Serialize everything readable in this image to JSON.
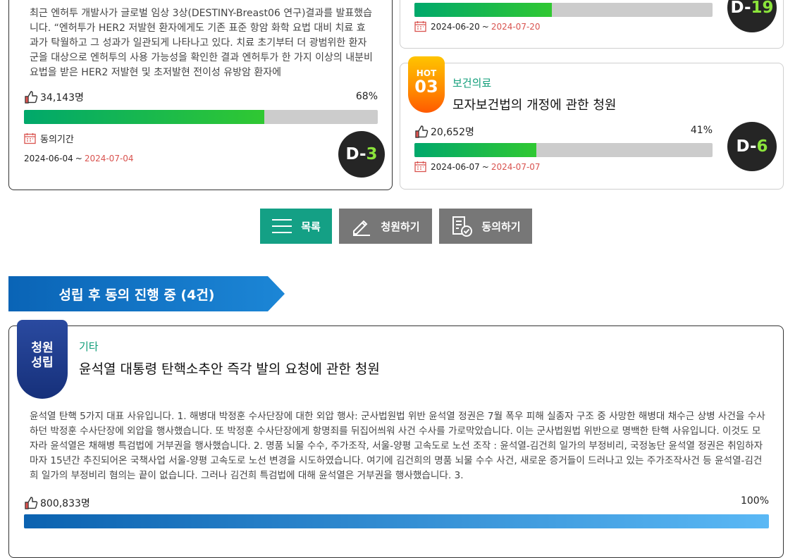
{
  "card1": {
    "description": "최근 엔허투 개발사가 글로벌 임상 3상(DESTINY-Breast06 연구)결과를 발표했습니다. “엔허투가 HER2 저발현 환자에게도 기존 표준 항암 화학 요법 대비 치료 효과가 탁월하고 그 성과가 일관되게 나타나고 있다. 치료 초기부터 더 광범위한 환자군을 대상으로 엔허투의 사용 가능성을 확인한 결과 엔허투가 한 가지 이상의 내분비 요법을 받은 HER2 저발현 및 초저발현 전이성 유방암 환자에",
    "count": "34,143명",
    "percent": "68%",
    "progress": 0.68,
    "period_label": "동의기간",
    "start_date": "2024-06-04",
    "sep": "~",
    "end_date": "2024-07-04",
    "d_prefix": "D-",
    "d_num": "3"
  },
  "card2": {
    "start_date": "2024-06-20",
    "sep": "~",
    "end_date": "2024-07-20",
    "progress": 0.46,
    "d_prefix": "D-",
    "d_num": "19"
  },
  "card3": {
    "hot_label": "HOT",
    "hot_num": "03",
    "category": "보건의료",
    "title": "모자보건법의 개정에 관한 청원",
    "count": "20,652명",
    "percent": "41%",
    "progress": 0.41,
    "start_date": "2024-06-07",
    "sep": "~",
    "end_date": "2024-07-07",
    "d_prefix": "D-",
    "d_num": "6"
  },
  "buttons": {
    "list": "목록",
    "petition": "청원하기",
    "agree": "동의하기"
  },
  "section": {
    "title": "성립 후 동의 진행 중 (4건)"
  },
  "card4": {
    "ribbon_line1": "청원",
    "ribbon_line2": "성립",
    "category": "기타",
    "title": "윤석열 대통령 탄핵소추안 즉각 발의 요청에 관한 청원",
    "description": "윤석열 탄핵 5가지 대표 사유입니다. 1. 해병대 박정훈 수사단장에 대한 외압 행사: 군사법원법 위반 윤석열 정권은 7월 폭우 피해 실종자 구조 중 사망한 해병대 채수근 상병 사건을 수사하던 박정훈 수사단장에 외압을 행사했습니다. 또 박정훈 수사단장에게 항명죄를 뒤집어씌워 사건 수사를 가로막았습니다. 이는 군사법원법 위반으로 명백한 탄핵 사유입니다. 이것도 모자라 윤석열은 채해병 특검법에 거부권을 행사했습니다. 2. 명품 뇌물 수수, 주가조작, 서울-양평 고속도로 노선 조작 : 윤석열-김건희 일가의 부정비리, 국정농단 윤석열 정권은 취임하자마자 15년간 추진되어온 국책사업 서울-양평 고속도로 노선 변경을 시도하였습니다. 여기에 김건희의 명품 뇌물 수수 사건, 새로운 증거들이 드러나고 있는 주가조작사건 등 윤석열-김건희 일가의 부정비리 혐의는 끝이 없습니다. 그러나 김건희 특검법에 대해 윤석열은 거부권을 행사했습니다. 3.",
    "count": "800,833명",
    "percent": "100%",
    "progress": 1.0
  },
  "colors": {
    "accent_teal": "#129e7a",
    "button_gray": "#777777",
    "date_end_red": "#d9534f",
    "banner_blue": "#0a6bbd"
  }
}
